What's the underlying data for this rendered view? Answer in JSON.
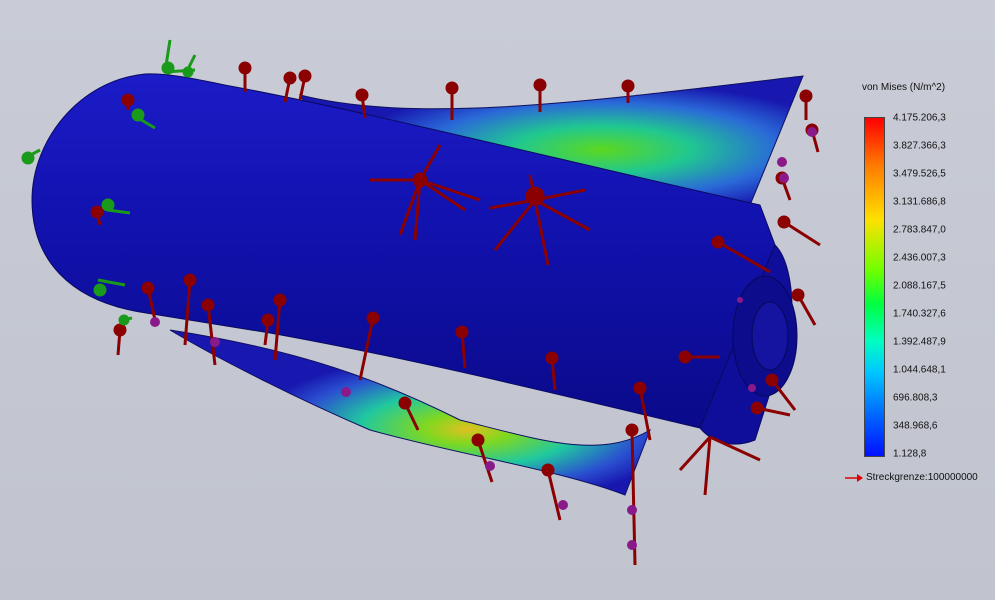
{
  "legend": {
    "title": "von Mises (N/m^2)",
    "ticks": [
      "4.175.206,3",
      "3.827.366,3",
      "3.479.526,5",
      "3.131.686,8",
      "2.783.847,0",
      "2.436.007,3",
      "2.088.167,5",
      "1.740.327,6",
      "1.392.487,9",
      "1.044.648,1",
      "696.808,3",
      "348.968,6",
      "1.128,8"
    ],
    "yield_label": "Streckgrenze:100000000"
  },
  "colors": {
    "model_blue": "#1010a8",
    "load_arrow": "#8b0000",
    "fixture_green": "#1a9a1a",
    "pin_purple": "#8a1a8a",
    "yield_arrow": "#e00000"
  }
}
